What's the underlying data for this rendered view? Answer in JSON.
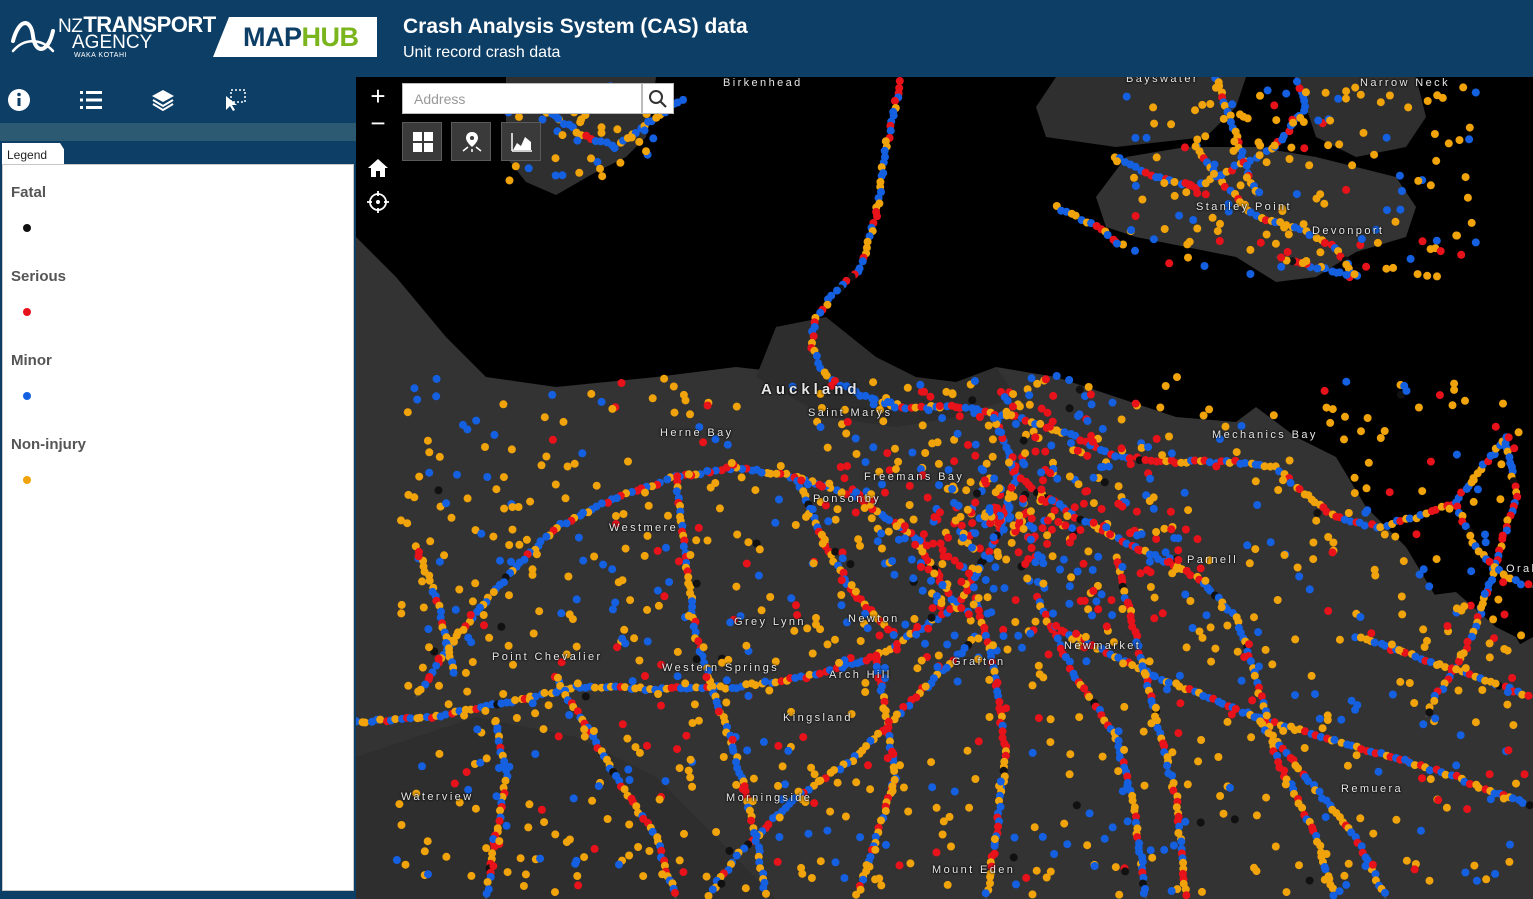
{
  "header": {
    "org_line1_prefix": "NZ",
    "org_line1_main": "TRANSPORT",
    "org_line2": "AGENCY",
    "org_line3": "WAKA KOTAHI",
    "badge_map": "MAP",
    "badge_hub": "HUB",
    "title": "Crash Analysis System (CAS) data",
    "subtitle": "Unit record crash data"
  },
  "sidebar": {
    "toolbar_icons": [
      "info-icon",
      "list-icon",
      "layers-icon",
      "select-tool-icon"
    ],
    "legend_tab": "Legend",
    "legend": [
      {
        "label": "Fatal",
        "color": "#111111"
      },
      {
        "label": "Serious",
        "color": "#e8121b"
      },
      {
        "label": "Minor",
        "color": "#1460e0"
      },
      {
        "label": "Non-injury",
        "color": "#f0a30a"
      }
    ]
  },
  "map": {
    "search_placeholder": "Address",
    "controls": [
      "zoom-in-icon",
      "zoom-out-icon",
      "home-icon",
      "locate-icon",
      "basemap-gallery-icon",
      "directions-icon",
      "elevation-profile-icon",
      "search-icon"
    ],
    "zoom_in_label": "+",
    "zoom_out_label": "−",
    "labels": [
      "Birkenhead",
      "Bayswater",
      "Narrow Neck",
      "Stanley Point",
      "Devonport",
      "Auckland",
      "Saint Marys",
      "Herne Bay",
      "Mechanics Bay",
      "Freemans Bay",
      "Ponsonby",
      "Westmere",
      "Parnell",
      "Grey Lynn",
      "Newton",
      "Point Chevalier",
      "Western Springs",
      "Newmarket",
      "Grafton",
      "Arch Hill",
      "Kingsland",
      "Waterview",
      "Morningside",
      "Remuera",
      "Mount Eden",
      "Orakei"
    ],
    "colors": {
      "fatal": "#111111",
      "serious": "#e8121b",
      "minor": "#1460e0",
      "non_injury": "#f0a30a",
      "water": "#000000",
      "land": "#333333"
    }
  }
}
